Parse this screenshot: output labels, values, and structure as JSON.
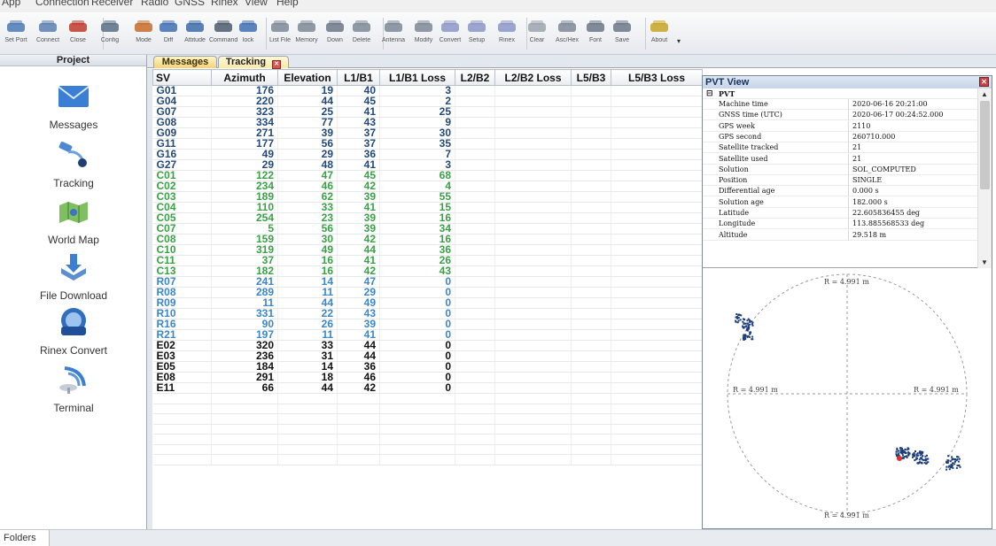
{
  "menu": [
    "App",
    "Connection",
    "Receiver",
    "Radio",
    "GNSS",
    "Rinex",
    "View",
    "Help"
  ],
  "toolbar": {
    "buttons": [
      {
        "label": "Set Port",
        "icon": "serial-port-icon"
      },
      {
        "label": "Connect",
        "icon": "connect-icon"
      },
      {
        "label": "Close",
        "icon": "disconnect-icon"
      },
      {
        "label": "Config",
        "icon": "config-icon"
      },
      {
        "label": "Mode",
        "icon": "mode-icon"
      },
      {
        "label": "Diff",
        "icon": "diff-icon"
      },
      {
        "label": "Attitude",
        "icon": "attitude-icon"
      },
      {
        "label": "Command",
        "icon": "command-icon"
      },
      {
        "label": "lock",
        "icon": "lock-icon"
      },
      {
        "label": "List File",
        "icon": "list-file-icon"
      },
      {
        "label": "Memory",
        "icon": "memory-icon"
      },
      {
        "label": "Down",
        "icon": "download-icon"
      },
      {
        "label": "Delete",
        "icon": "delete-icon"
      },
      {
        "label": "Antenna",
        "icon": "antenna-icon"
      },
      {
        "label": "Modify",
        "icon": "modify-icon"
      },
      {
        "label": "Convert",
        "icon": "rinex-convert-icon"
      },
      {
        "label": "Setup",
        "icon": "rinex-setup-icon"
      },
      {
        "label": "Rinex",
        "icon": "rinex-icon"
      },
      {
        "label": "Clear",
        "icon": "clear-icon"
      },
      {
        "label": "Asc/Hex",
        "icon": "asc-hex-icon"
      },
      {
        "label": "Font",
        "icon": "font-icon"
      },
      {
        "label": "Save",
        "icon": "save-icon"
      },
      {
        "label": "About",
        "icon": "about-icon"
      }
    ]
  },
  "sidebar": {
    "title": "Project",
    "items": [
      {
        "label": "Messages",
        "icon": "envelope-icon"
      },
      {
        "label": "Tracking",
        "icon": "satellite-icon"
      },
      {
        "label": "World Map",
        "icon": "world-map-icon"
      },
      {
        "label": "File Download",
        "icon": "file-download-icon"
      },
      {
        "label": "Rinex Convert",
        "icon": "rinex-logo-icon"
      },
      {
        "label": "Terminal",
        "icon": "terminal-dish-icon"
      }
    ]
  },
  "tabs": {
    "messages": "Messages",
    "tracking": "Tracking"
  },
  "table": {
    "headers": [
      "SV",
      "Azimuth",
      "Elevation",
      "L1/B1",
      "L1/B1 Loss",
      "L2/B2",
      "L2/B2 Loss",
      "L5/B3",
      "L5/B3 Loss"
    ],
    "rows": [
      {
        "sys": "gps",
        "cells": [
          "G01",
          "176",
          "19",
          "40",
          "3",
          "",
          "",
          "",
          ""
        ]
      },
      {
        "sys": "gps",
        "cells": [
          "G04",
          "220",
          "44",
          "45",
          "2",
          "",
          "",
          "",
          ""
        ]
      },
      {
        "sys": "gps",
        "cells": [
          "G07",
          "323",
          "25",
          "41",
          "25",
          "",
          "",
          "",
          ""
        ]
      },
      {
        "sys": "gps",
        "cells": [
          "G08",
          "334",
          "77",
          "43",
          "9",
          "",
          "",
          "",
          ""
        ]
      },
      {
        "sys": "gps",
        "cells": [
          "G09",
          "271",
          "39",
          "37",
          "30",
          "",
          "",
          "",
          ""
        ]
      },
      {
        "sys": "gps",
        "cells": [
          "G11",
          "177",
          "56",
          "37",
          "35",
          "",
          "",
          "",
          ""
        ]
      },
      {
        "sys": "gps",
        "cells": [
          "G16",
          "49",
          "29",
          "36",
          "7",
          "",
          "",
          "",
          ""
        ]
      },
      {
        "sys": "gps",
        "cells": [
          "G27",
          "29",
          "48",
          "41",
          "3",
          "",
          "",
          "",
          ""
        ]
      },
      {
        "sys": "bds",
        "cells": [
          "C01",
          "122",
          "47",
          "45",
          "68",
          "",
          "",
          "",
          ""
        ]
      },
      {
        "sys": "bds",
        "cells": [
          "C02",
          "234",
          "46",
          "42",
          "4",
          "",
          "",
          "",
          ""
        ]
      },
      {
        "sys": "bds",
        "cells": [
          "C03",
          "189",
          "62",
          "39",
          "55",
          "",
          "",
          "",
          ""
        ]
      },
      {
        "sys": "bds",
        "cells": [
          "C04",
          "110",
          "33",
          "41",
          "15",
          "",
          "",
          "",
          ""
        ]
      },
      {
        "sys": "bds",
        "cells": [
          "C05",
          "254",
          "23",
          "39",
          "16",
          "",
          "",
          "",
          ""
        ]
      },
      {
        "sys": "bds",
        "cells": [
          "C07",
          "5",
          "56",
          "39",
          "34",
          "",
          "",
          "",
          ""
        ]
      },
      {
        "sys": "bds",
        "cells": [
          "C08",
          "159",
          "30",
          "42",
          "16",
          "",
          "",
          "",
          ""
        ]
      },
      {
        "sys": "bds",
        "cells": [
          "C10",
          "319",
          "49",
          "44",
          "36",
          "",
          "",
          "",
          ""
        ]
      },
      {
        "sys": "bds",
        "cells": [
          "C11",
          "37",
          "16",
          "41",
          "26",
          "",
          "",
          "",
          ""
        ]
      },
      {
        "sys": "bds",
        "cells": [
          "C13",
          "182",
          "16",
          "42",
          "43",
          "",
          "",
          "",
          ""
        ]
      },
      {
        "sys": "glo",
        "cells": [
          "R07",
          "241",
          "14",
          "47",
          "0",
          "",
          "",
          "",
          ""
        ]
      },
      {
        "sys": "glo",
        "cells": [
          "R08",
          "289",
          "11",
          "29",
          "0",
          "",
          "",
          "",
          ""
        ]
      },
      {
        "sys": "glo",
        "cells": [
          "R09",
          "11",
          "44",
          "49",
          "0",
          "",
          "",
          "",
          ""
        ]
      },
      {
        "sys": "glo",
        "cells": [
          "R10",
          "331",
          "22",
          "43",
          "0",
          "",
          "",
          "",
          ""
        ]
      },
      {
        "sys": "glo",
        "cells": [
          "R16",
          "90",
          "26",
          "39",
          "0",
          "",
          "",
          "",
          ""
        ]
      },
      {
        "sys": "glo",
        "cells": [
          "R21",
          "197",
          "11",
          "41",
          "0",
          "",
          "",
          "",
          ""
        ]
      },
      {
        "sys": "gal",
        "cells": [
          "E02",
          "320",
          "33",
          "44",
          "0",
          "",
          "",
          "",
          ""
        ]
      },
      {
        "sys": "gal",
        "cells": [
          "E03",
          "236",
          "31",
          "44",
          "0",
          "",
          "",
          "",
          ""
        ]
      },
      {
        "sys": "gal",
        "cells": [
          "E05",
          "184",
          "14",
          "36",
          "0",
          "",
          "",
          "",
          ""
        ]
      },
      {
        "sys": "gal",
        "cells": [
          "E08",
          "291",
          "18",
          "46",
          "0",
          "",
          "",
          "",
          ""
        ]
      },
      {
        "sys": "gal",
        "cells": [
          "E11",
          "66",
          "44",
          "42",
          "0",
          "",
          "",
          "",
          ""
        ]
      }
    ],
    "empty_rows": 7,
    "colors": {
      "gps": "#21497a",
      "bds": "#3aa046",
      "glo": "#3b86c6",
      "gal": "#111111"
    }
  },
  "pvt": {
    "title": "PVT View",
    "group": "PVT",
    "rows": [
      {
        "key": "Machine time",
        "value": "2020-06-16 20:21:00"
      },
      {
        "key": "GNSS time (UTC)",
        "value": "2020-06-17 00:24:52.000"
      },
      {
        "key": "GPS week",
        "value": "2110"
      },
      {
        "key": "GPS second",
        "value": "260710.000"
      },
      {
        "key": "Satellite tracked",
        "value": "21"
      },
      {
        "key": "Satellite used",
        "value": "21"
      },
      {
        "key": "Solution",
        "value": "SOL_COMPUTED"
      },
      {
        "key": "Position",
        "value": "SINGLE"
      },
      {
        "key": "Differential age",
        "value": "0.000 s"
      },
      {
        "key": "Solution age",
        "value": "182.000 s"
      },
      {
        "key": "Latitude",
        "value": "22.605836455 deg"
      },
      {
        "key": "Longitude",
        "value": "113.885568533 deg"
      },
      {
        "key": "Altitude",
        "value": "29.518 m"
      }
    ],
    "scatter_labels": {
      "top": "R = 4.991 m",
      "left": "R = 4.991 m",
      "right": "R = 4.991 m",
      "bottom": "R = 4.991 m"
    }
  },
  "status": {
    "tab": "Folders"
  }
}
